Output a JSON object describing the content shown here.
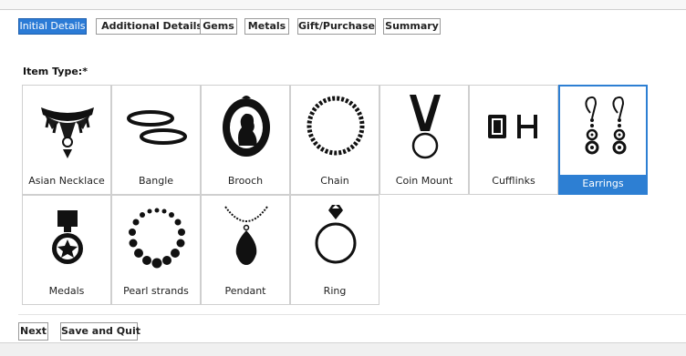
{
  "tabs": [
    {
      "label": "Initial Details",
      "active": true
    },
    {
      "label": "Additional Details",
      "active": false
    },
    {
      "label": "Gems",
      "active": false
    },
    {
      "label": "Metals",
      "active": false
    },
    {
      "label": "Gift/Purchase",
      "active": false
    },
    {
      "label": "Summary",
      "active": false
    }
  ],
  "item_type": {
    "label": "Item Type:*",
    "selected": "Earrings",
    "options": [
      {
        "label": "Asian Necklace",
        "icon": "asian-necklace-icon"
      },
      {
        "label": "Bangle",
        "icon": "bangle-icon"
      },
      {
        "label": "Brooch",
        "icon": "brooch-icon"
      },
      {
        "label": "Chain",
        "icon": "chain-icon"
      },
      {
        "label": "Coin Mount",
        "icon": "coin-mount-icon"
      },
      {
        "label": "Cufflinks",
        "icon": "cufflinks-icon"
      },
      {
        "label": "Earrings",
        "icon": "earrings-icon"
      },
      {
        "label": "Medals",
        "icon": "medal-icon"
      },
      {
        "label": "Pearl strands",
        "icon": "pearl-strands-icon"
      },
      {
        "label": "Pendant",
        "icon": "pendant-icon"
      },
      {
        "label": "Ring",
        "icon": "ring-icon"
      }
    ]
  },
  "actions": {
    "next_label": "Next",
    "save_quit_label": "Save and Quit"
  },
  "colors": {
    "accent": "#2d7fd3",
    "tab_active": "#2b7bd6",
    "border": "#cfcfcf"
  }
}
